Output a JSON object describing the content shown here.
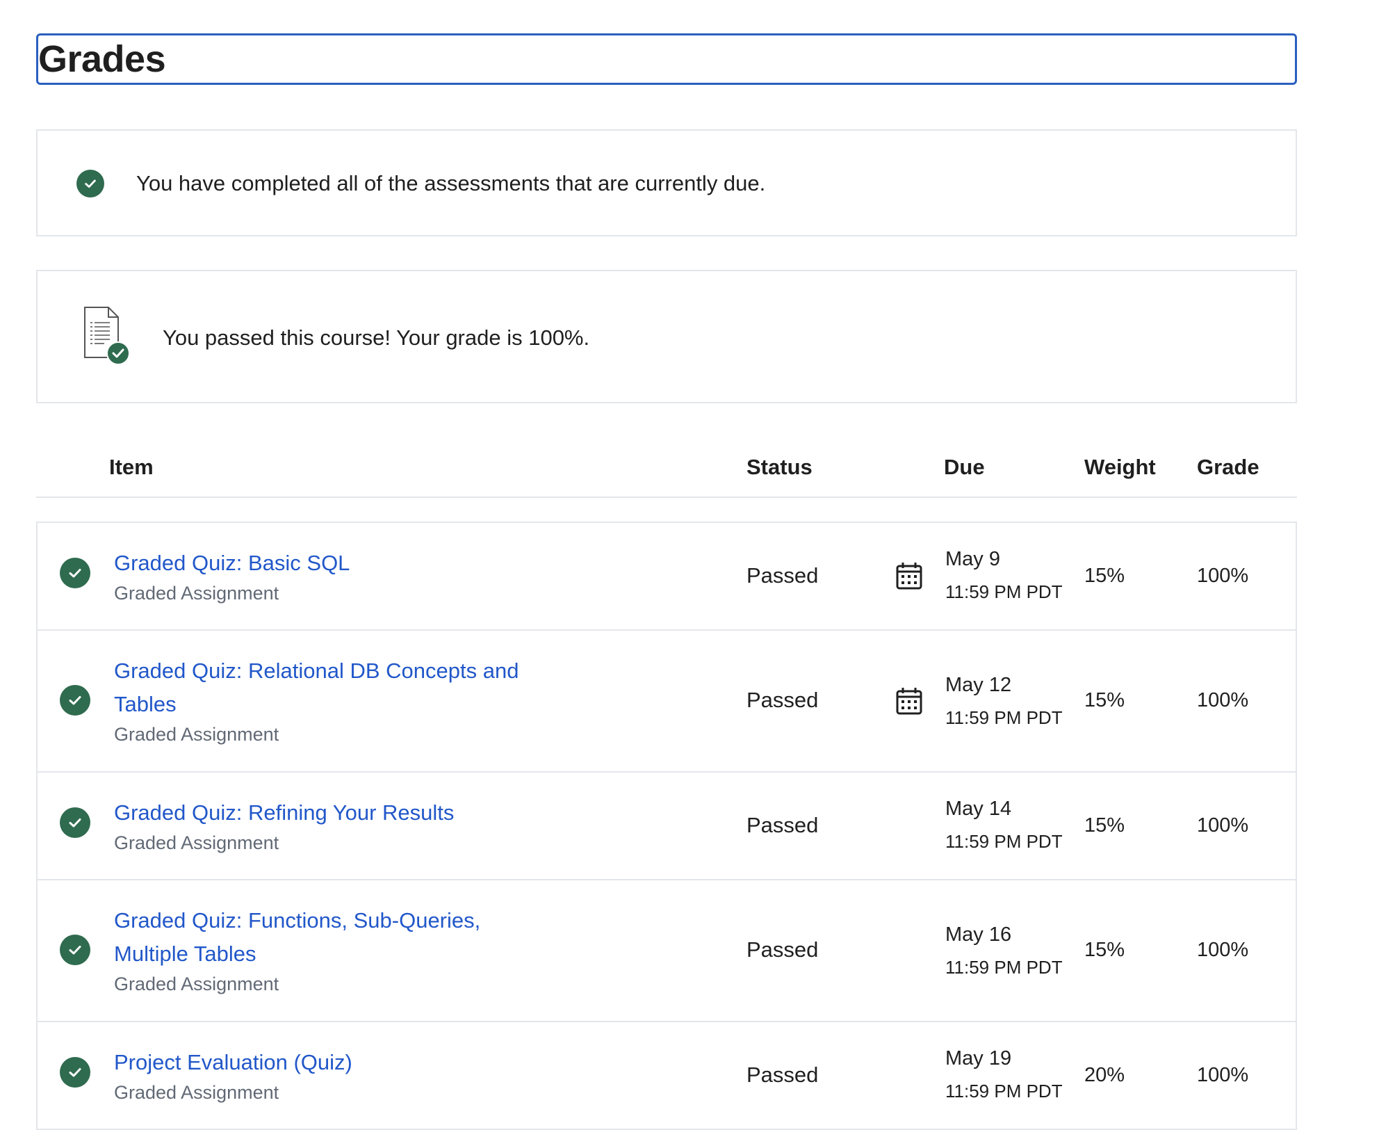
{
  "page": {
    "title": "Grades"
  },
  "notices": {
    "completed_message": "You have completed all of the assessments that are currently due.",
    "passed_message": "You passed this course! Your grade is 100%."
  },
  "table": {
    "headers": {
      "item": "Item",
      "status": "Status",
      "due": "Due",
      "weight": "Weight",
      "grade": "Grade"
    },
    "rows": [
      {
        "title": "Graded Quiz: Basic SQL",
        "type": "Graded Assignment",
        "status": "Passed",
        "due_date": "May 9",
        "due_time": "11:59 PM PDT",
        "weight": "15%",
        "grade": "100%",
        "calendar_icon": true
      },
      {
        "title": "Graded Quiz: Relational DB Concepts and Tables",
        "type": "Graded Assignment",
        "status": "Passed",
        "due_date": "May 12",
        "due_time": "11:59 PM PDT",
        "weight": "15%",
        "grade": "100%",
        "calendar_icon": true
      },
      {
        "title": "Graded Quiz: Refining Your Results",
        "type": "Graded Assignment",
        "status": "Passed",
        "due_date": "May 14",
        "due_time": "11:59 PM PDT",
        "weight": "15%",
        "grade": "100%",
        "calendar_icon": false
      },
      {
        "title": "Graded Quiz: Functions, Sub-Queries, Multiple Tables",
        "type": "Graded Assignment",
        "status": "Passed",
        "due_date": "May 16",
        "due_time": "11:59 PM PDT",
        "weight": "15%",
        "grade": "100%",
        "calendar_icon": false
      },
      {
        "title": "Project Evaluation (Quiz)",
        "type": "Graded Assignment",
        "status": "Passed",
        "due_date": "May 19",
        "due_time": "11:59 PM PDT",
        "weight": "20%",
        "grade": "100%",
        "calendar_icon": false
      }
    ]
  },
  "colors": {
    "accent_link": "#2157c9",
    "success_green": "#2f6b4f",
    "focus_border": "#2a5fbf",
    "border": "#e3e6ea",
    "muted_text": "#616975"
  },
  "icons": {
    "status": "check-circle-icon",
    "certificate": "document-check-icon",
    "due": "calendar-icon"
  }
}
